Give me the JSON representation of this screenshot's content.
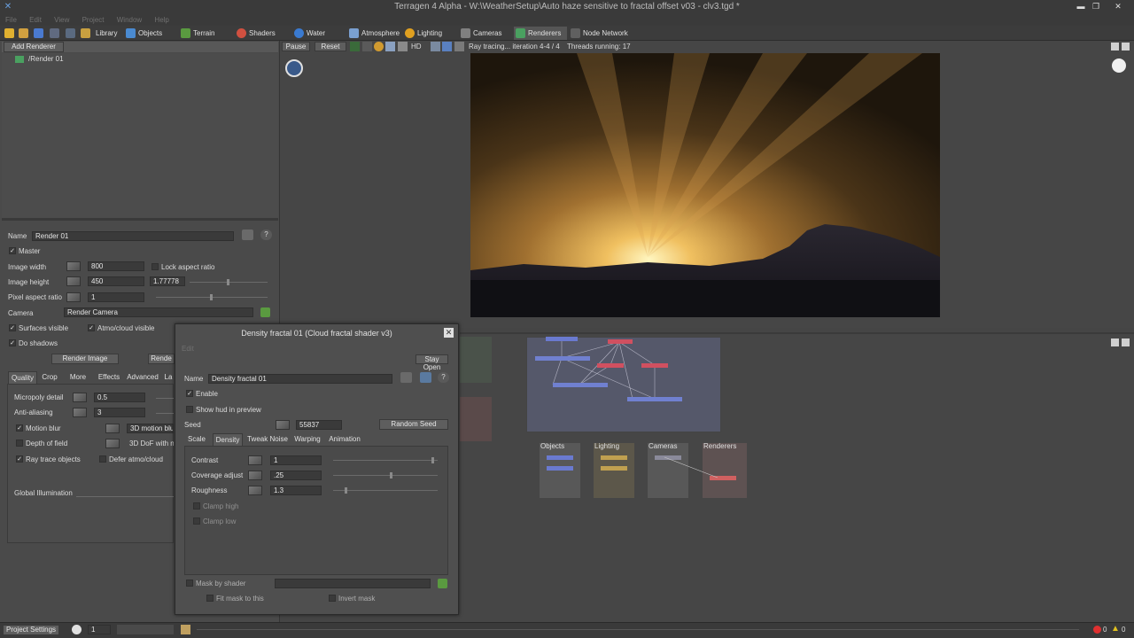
{
  "window": {
    "title": "Terragen 4 Alpha - W:\\WeatherSetup\\Auto haze sensitive to fractal offset v03 - clv3.tgd *"
  },
  "menu": [
    "File",
    "Edit",
    "View",
    "Project",
    "Window",
    "Help"
  ],
  "tabs": [
    {
      "label": "Library",
      "color": "#c8a040"
    },
    {
      "label": "Objects",
      "color": "#4a8ad0"
    },
    {
      "label": "Terrain",
      "color": "#5a9a40"
    },
    {
      "label": "Shaders",
      "color": "#d05040"
    },
    {
      "label": "Water",
      "color": "#3a7ad0"
    },
    {
      "label": "Atmosphere",
      "color": "#7aa0d0"
    },
    {
      "label": "Lighting",
      "color": "#e0a020"
    },
    {
      "label": "Cameras",
      "color": "#808080"
    },
    {
      "label": "Renderers",
      "color": "#4aa060"
    },
    {
      "label": "Node Network",
      "color": "#606060"
    }
  ],
  "left": {
    "add_renderer": "Add Renderer",
    "render_item": "/Render 01",
    "name_label": "Name",
    "name_value": "Render 01",
    "master": "Master",
    "image_width_label": "Image width",
    "image_width": "800",
    "lock_aspect": "Lock aspect ratio",
    "image_height_label": "Image height",
    "image_height": "450",
    "aspect_value": "1.77778",
    "pixel_aspect_label": "Pixel aspect ratio",
    "pixel_aspect": "1",
    "camera_label": "Camera",
    "camera_value": "Render Camera",
    "surfaces_visible": "Surfaces visible",
    "atmo_visible": "Atmo/cloud visible",
    "do_shadows": "Do shadows",
    "render_image": "Render Image",
    "render_partial": "Rende",
    "subtabs": [
      "Quality",
      "Crop",
      "More",
      "Effects",
      "Advanced",
      "La"
    ],
    "micropoly_label": "Micropoly detail",
    "micropoly": "0.5",
    "antialias_label": "Anti-aliasing",
    "antialias": "3",
    "motion_blur": "Motion blur",
    "motion_3d": "3D motion blu",
    "depth_of_field": "Depth of field",
    "dof_3d": "3D DoF with n",
    "ray_trace": "Ray trace objects",
    "defer_atmo": "Defer atmo/cloud",
    "global_illum": "Global Illumination"
  },
  "render": {
    "pause": "Pause",
    "reset": "Reset",
    "hd": "HD",
    "status": "Ray tracing... iteration 4-4 / 4",
    "threads": "Threads running: 17"
  },
  "dialog": {
    "title": "Density fractal 01    (Cloud fractal shader v3)",
    "edit": "Edit",
    "stay_open": "Stay Open",
    "name_label": "Name",
    "name_value": "Density fractal 01",
    "enable": "Enable",
    "show_hud": "Show hud in preview",
    "seed_label": "Seed",
    "seed_value": "55837",
    "random_seed": "Random Seed",
    "tabs": [
      "Scale",
      "Density",
      "Tweak Noise",
      "Warping",
      "Animation"
    ],
    "contrast_label": "Contrast",
    "contrast": "1",
    "contrast_level": 0.95,
    "coverage_label": "Coverage adjust",
    "coverage": ".25",
    "coverage_level": 0.55,
    "roughness_label": "Roughness",
    "roughness": "1.3",
    "roughness_level": 0.12,
    "clamp_high": "Clamp high",
    "clamp_low": "Clamp low",
    "mask_by_shader": "Mask by shader",
    "fit_mask": "Fit mask to this",
    "invert_mask": "Invert mask"
  },
  "nodes": {
    "groups": [
      "Objects",
      "Lighting",
      "Cameras",
      "Renderers"
    ]
  },
  "status": {
    "project_settings": "Project Settings",
    "frame": "1",
    "errors": "0",
    "warnings": "0"
  }
}
